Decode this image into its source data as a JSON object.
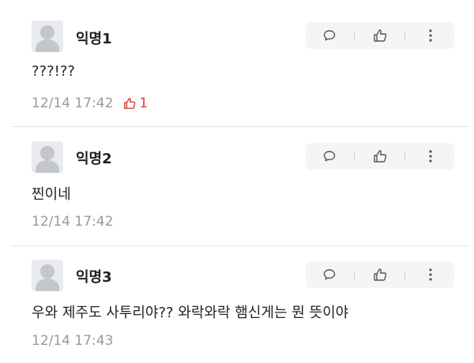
{
  "comments": [
    {
      "author": "익명1",
      "text": "???!??",
      "time": "12/14 17:42",
      "likes": "1"
    },
    {
      "author": "익명2",
      "text": "찐이네",
      "time": "12/14 17:42",
      "likes": ""
    },
    {
      "author": "익명3",
      "text": "우와 제주도 사투리야?? 와락와락 햄신게는 뭔 뜻이야",
      "time": "12/14 17:43",
      "likes": ""
    }
  ],
  "icons": {
    "reply": "speech-bubble-icon",
    "like": "thumbs-up-icon",
    "more": "more-vertical-icon"
  },
  "colors": {
    "like_accent": "#d1423a",
    "meta_gray": "#9a9a9a",
    "action_bg": "#f4f5f7"
  }
}
